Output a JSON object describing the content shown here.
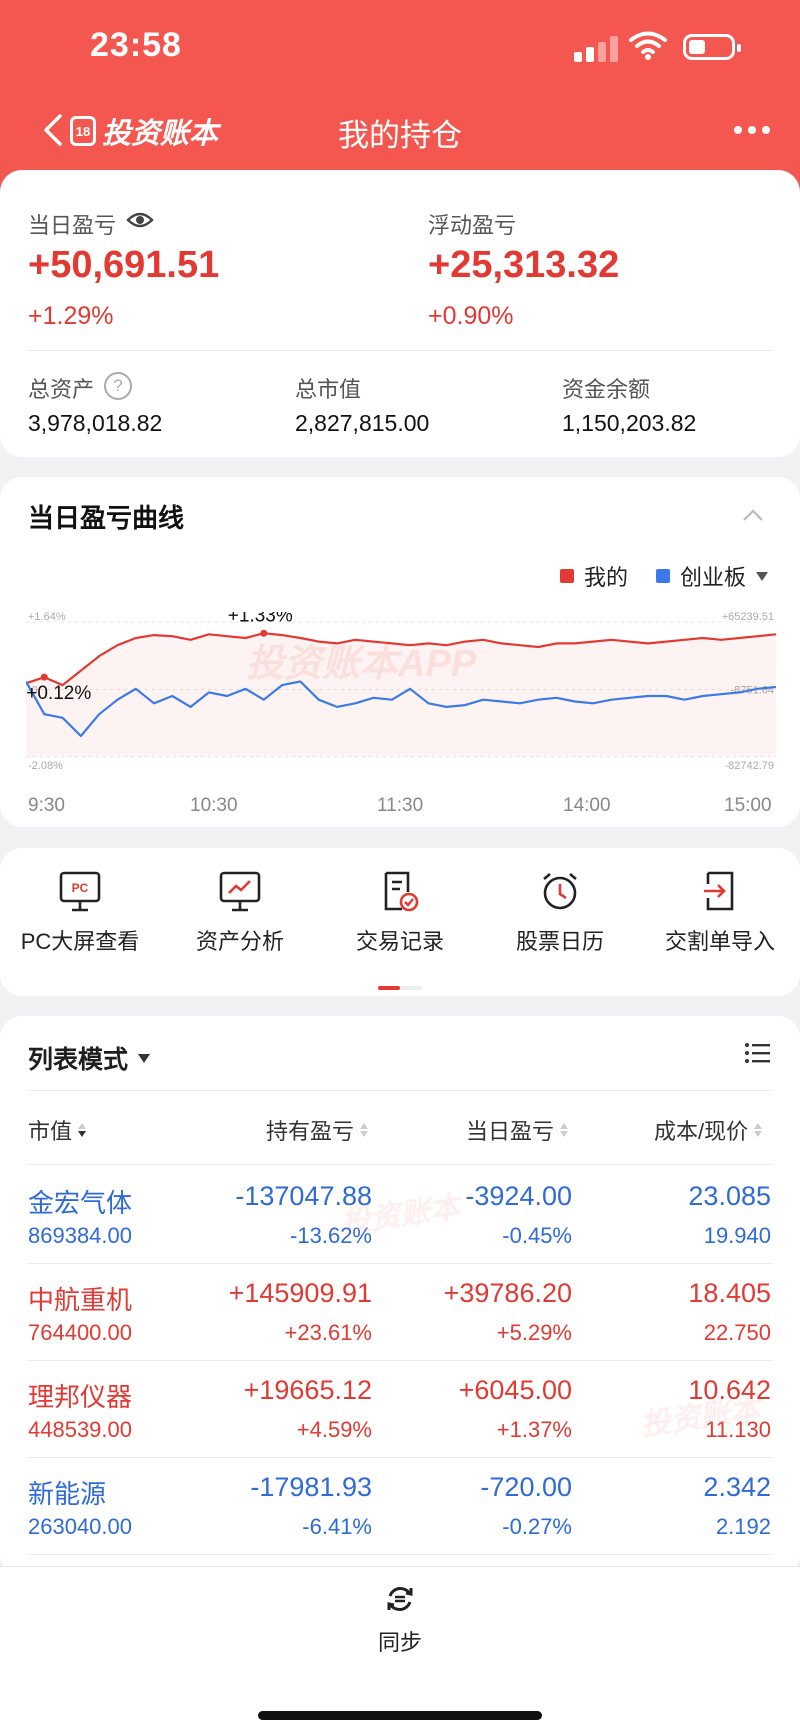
{
  "status_bar": {
    "time": "23:58"
  },
  "nav": {
    "logo_text": "投资账本",
    "logo_mark": "18",
    "title": "我的持仓"
  },
  "summary": {
    "daily_pl": {
      "label": "当日盈亏",
      "value": "+50,691.51",
      "pct": "+1.29%"
    },
    "float_pl": {
      "label": "浮动盈亏",
      "value": "+25,313.32",
      "pct": "+0.90%"
    },
    "total_assets": {
      "label": "总资产",
      "value": "3,978,018.82",
      "help": "?"
    },
    "market_value": {
      "label": "总市值",
      "value": "2,827,815.00"
    },
    "cash_balance": {
      "label": "资金余额",
      "value": "1,150,203.82"
    }
  },
  "chart_section": {
    "title": "当日盈亏曲线",
    "legend": [
      {
        "name": "我的",
        "color": "#e23a33"
      },
      {
        "name": "创业板",
        "color": "#3b7be8"
      }
    ],
    "watermark": "投资账本APP"
  },
  "chart_data": {
    "type": "line",
    "x_ticks": [
      "9:30",
      "10:30",
      "11:30",
      "14:00",
      "15:00"
    ],
    "left_axis": {
      "max": "+1.64%",
      "mid": "-0.",
      "min": "-2.08%"
    },
    "right_axis": {
      "max": "+65239.51",
      "mid": "-8751.64",
      "min": "-82742.79"
    },
    "ylim": [
      -2.08,
      1.64
    ],
    "series": [
      {
        "name": "我的",
        "color": "#e23a33",
        "values": [
          -0.05,
          0.12,
          -0.1,
          0.3,
          0.7,
          1.0,
          1.2,
          1.28,
          1.25,
          1.15,
          1.3,
          1.25,
          1.2,
          1.33,
          1.28,
          1.2,
          1.1,
          1.05,
          1.15,
          1.1,
          1.05,
          1.0,
          1.05,
          1.0,
          1.1,
          1.15,
          1.05,
          1.0,
          0.95,
          1.05,
          1.05,
          1.1,
          1.15,
          1.1,
          1.05,
          1.1,
          1.15,
          1.2,
          1.15,
          1.2,
          1.25,
          1.3
        ]
      },
      {
        "name": "创业板",
        "color": "#3b7be8",
        "values": [
          0.0,
          -0.9,
          -1.0,
          -1.5,
          -0.9,
          -0.5,
          -0.2,
          -0.6,
          -0.4,
          -0.7,
          -0.3,
          -0.4,
          -0.2,
          -0.5,
          -0.1,
          0.0,
          -0.5,
          -0.7,
          -0.6,
          -0.45,
          -0.5,
          -0.2,
          -0.6,
          -0.7,
          -0.65,
          -0.5,
          -0.55,
          -0.6,
          -0.5,
          -0.45,
          -0.55,
          -0.6,
          -0.5,
          -0.45,
          -0.4,
          -0.4,
          -0.5,
          -0.4,
          -0.35,
          -0.3,
          -0.2,
          -0.15
        ]
      }
    ],
    "annotations": [
      {
        "text": "+1.33%",
        "series": "我的",
        "index": 13
      },
      {
        "text": "+0.12%",
        "series": "我的",
        "index": 1
      }
    ]
  },
  "menu": [
    {
      "label": "PC大屏查看",
      "icon": "pc-monitor-icon",
      "badge": "PC"
    },
    {
      "label": "资产分析",
      "icon": "chart-monitor-icon"
    },
    {
      "label": "交易记录",
      "icon": "document-check-icon"
    },
    {
      "label": "股票日历",
      "icon": "alarm-clock-icon"
    },
    {
      "label": "交割单导入",
      "icon": "import-document-icon"
    }
  ],
  "list": {
    "mode_label": "列表模式",
    "columns": [
      "市值",
      "持有盈亏",
      "当日盈亏",
      "成本/现价"
    ],
    "rows": [
      {
        "name": "金宏气体",
        "market_value": "869384.00",
        "hold_pl": "-137047.88",
        "hold_pct": "-13.62%",
        "day_pl": "-3924.00",
        "day_pct": "-0.45%",
        "cost": "23.085",
        "price": "19.940",
        "trend": "down"
      },
      {
        "name": "中航重机",
        "market_value": "764400.00",
        "hold_pl": "+145909.91",
        "hold_pct": "+23.61%",
        "day_pl": "+39786.20",
        "day_pct": "+5.29%",
        "cost": "18.405",
        "price": "22.750",
        "trend": "up"
      },
      {
        "name": "理邦仪器",
        "market_value": "448539.00",
        "hold_pl": "+19665.12",
        "hold_pct": "+4.59%",
        "day_pl": "+6045.00",
        "day_pct": "+1.37%",
        "cost": "10.642",
        "price": "11.130",
        "trend": "up"
      },
      {
        "name": "新能源",
        "market_value": "263040.00",
        "hold_pl": "-17981.93",
        "hold_pct": "-6.41%",
        "day_pl": "-720.00",
        "day_pct": "-0.27%",
        "cost": "2.342",
        "price": "2.192",
        "trend": "down"
      }
    ]
  },
  "tabbar": {
    "sync_label": "同步"
  },
  "watermarks": {
    "list_1": "投资账本",
    "list_2": "投资账本"
  }
}
